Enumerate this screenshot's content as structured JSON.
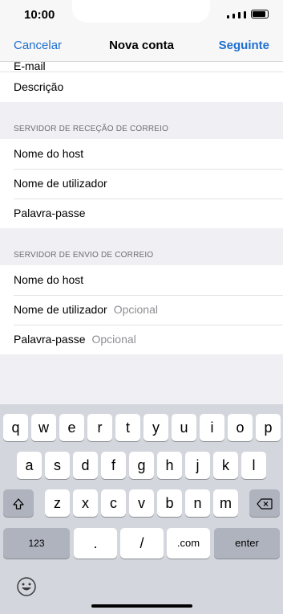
{
  "status_bar": {
    "time": "10:00"
  },
  "nav": {
    "cancel": "Cancelar",
    "title": "Nova conta",
    "next": "Seguinte"
  },
  "account": {
    "email_cut": "E-mail",
    "description": "Descrição"
  },
  "incoming": {
    "header": "SERVIDOR DE RECEÇÃO DE CORREIO",
    "host": "Nome do host",
    "user": "Nome de utilizador",
    "password": "Palavra-passe"
  },
  "outgoing": {
    "header": "SERVIDOR DE ENVIO DE CORREIO",
    "host": "Nome do host",
    "user": "Nome de utilizador",
    "user_placeholder": "Opcional",
    "password": "Palavra-passe",
    "password_placeholder": "Opcional"
  },
  "keyboard": {
    "row1": [
      "q",
      "w",
      "e",
      "r",
      "t",
      "y",
      "u",
      "i",
      "o",
      "p"
    ],
    "row2": [
      "a",
      "s",
      "d",
      "f",
      "g",
      "h",
      "j",
      "k",
      "l"
    ],
    "row3": [
      "z",
      "x",
      "c",
      "v",
      "b",
      "n",
      "m"
    ],
    "shift_icon": "shift-icon",
    "backspace_icon": "backspace-icon",
    "numbers": "123",
    "dot": ".",
    "slash": "/",
    "com": ".com",
    "enter": "enter",
    "emoji_icon": "emoji-icon"
  }
}
